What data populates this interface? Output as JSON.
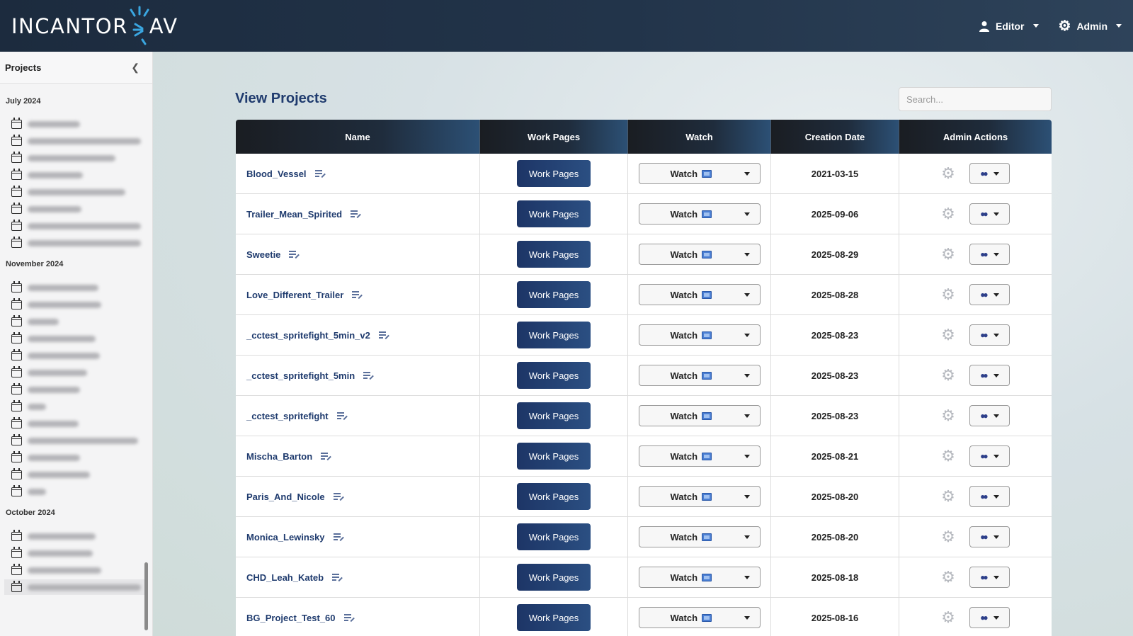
{
  "header": {
    "brand_left": "INCANTOR",
    "brand_right": "AV",
    "editor_label": "Editor",
    "admin_label": "Admin",
    "editor_icon": "user-icon",
    "admin_icon": "gear-icon"
  },
  "sidebar": {
    "title": "Projects",
    "collapse_icon": "chevron-left-icon",
    "groups": [
      {
        "label": "July 2024"
      },
      {
        "label": "November 2024"
      },
      {
        "label": "October 2024"
      }
    ]
  },
  "main": {
    "title": "View Projects",
    "search_placeholder": "Search..."
  },
  "table": {
    "headers": [
      "Name",
      "Work Pages",
      "Watch",
      "Creation Date",
      "Admin Actions"
    ],
    "work_pages_label": "Work Pages",
    "watch_label": "Watch",
    "rows": [
      {
        "name": "Blood_Vessel",
        "date": "2021-03-15"
      },
      {
        "name": "Trailer_Mean_Spirited",
        "date": "2025-09-06"
      },
      {
        "name": "Sweetie",
        "date": "2025-08-29"
      },
      {
        "name": "Love_Different_Trailer",
        "date": "2025-08-28"
      },
      {
        "name": "_cctest_spritefight_5min_v2",
        "date": "2025-08-23"
      },
      {
        "name": "_cctest_spritefight_5min",
        "date": "2025-08-23"
      },
      {
        "name": "_cctest_spritefight",
        "date": "2025-08-23"
      },
      {
        "name": "Mischa_Barton",
        "date": "2025-08-21"
      },
      {
        "name": "Paris_And_Nicole",
        "date": "2025-08-20"
      },
      {
        "name": "Monica_Lewinsky",
        "date": "2025-08-20"
      },
      {
        "name": "CHD_Leah_Kateb",
        "date": "2025-08-18"
      },
      {
        "name": "BG_Project_Test_60",
        "date": "2025-08-16"
      }
    ]
  },
  "colors": {
    "header_bg": "#1c2b3e",
    "accent_blue": "#1f3b6e",
    "button_blue": "#1d3566",
    "brand_accent": "#3aa6e0"
  }
}
